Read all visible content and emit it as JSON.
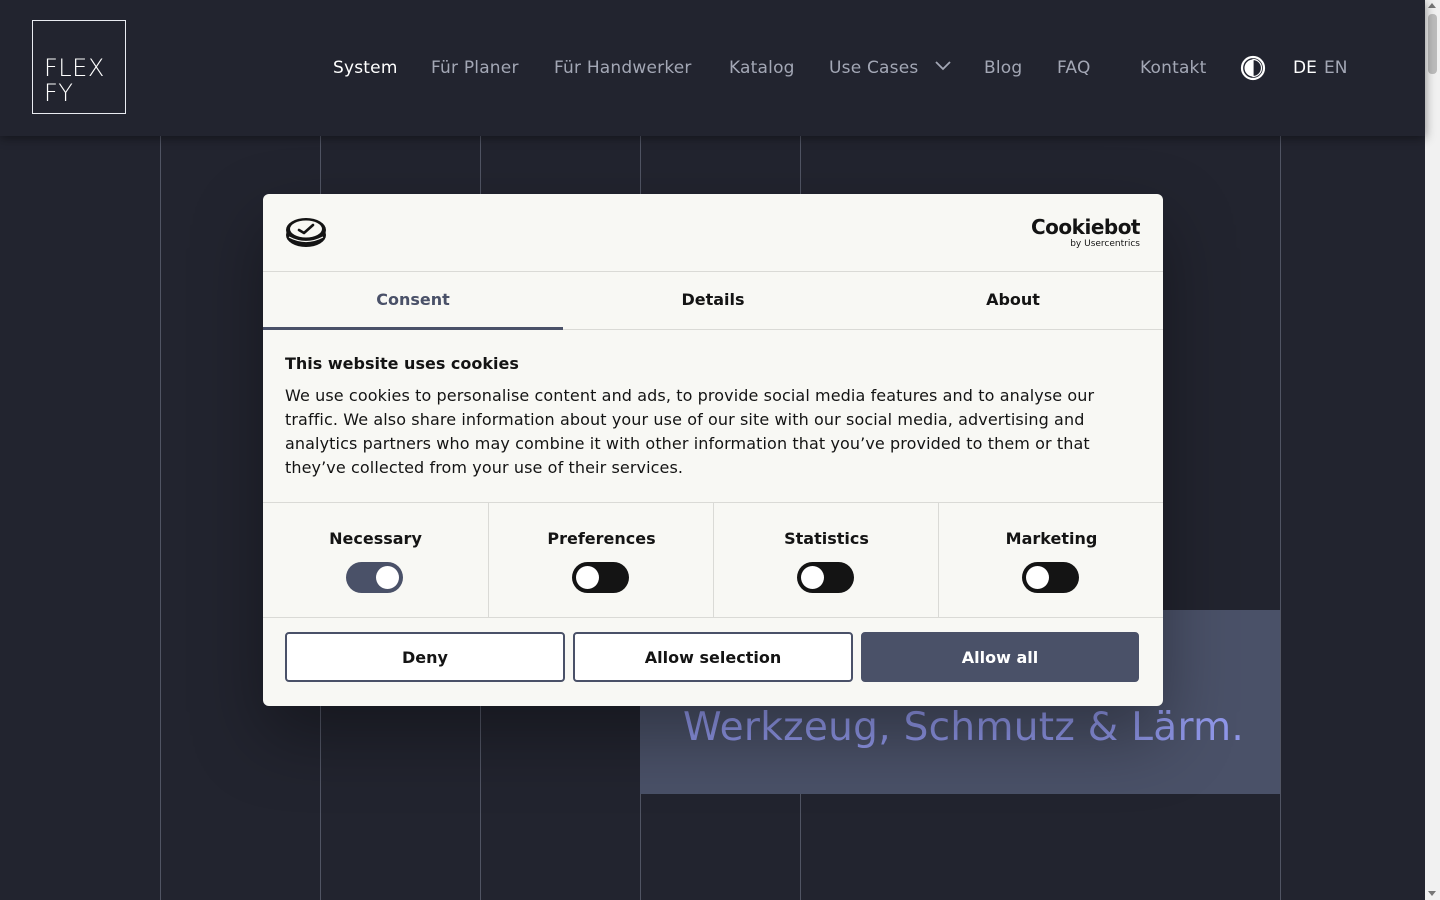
{
  "logo": {
    "line1": "FLEX",
    "line2": "FY"
  },
  "nav": {
    "items": [
      {
        "label": "System",
        "active": true
      },
      {
        "label": "Für Planer"
      },
      {
        "label": "Für Handwerker"
      },
      {
        "label": "Katalog"
      },
      {
        "label": "Use Cases",
        "has_dropdown": true
      },
      {
        "label": "Blog"
      },
      {
        "label": "FAQ"
      },
      {
        "label": "Kontakt"
      }
    ],
    "contrast_icon": "contrast-icon",
    "languages": [
      {
        "label": "DE",
        "active": true
      },
      {
        "label": "EN"
      }
    ]
  },
  "hero": {
    "text": "Werkzeug, Schmutz & Lärm."
  },
  "cookie_dialog": {
    "brand": {
      "name": "Cookiebot",
      "byline": "by Usercentrics"
    },
    "tabs": [
      {
        "label": "Consent",
        "active": true
      },
      {
        "label": "Details"
      },
      {
        "label": "About"
      }
    ],
    "title": "This website uses cookies",
    "body": "We use cookies to personalise content and ads, to provide social media features and to analyse our traffic. We also share information about your use of our site with our social media, advertising and analytics partners who may combine it with other information that you’ve provided to them or that they’ve collected from your use of their services.",
    "toggles": [
      {
        "label": "Necessary",
        "checked": true
      },
      {
        "label": "Preferences",
        "checked": false
      },
      {
        "label": "Statistics",
        "checked": false
      },
      {
        "label": "Marketing",
        "checked": false
      }
    ],
    "buttons": {
      "deny": "Deny",
      "allow_selection": "Allow selection",
      "allow_all": "Allow all"
    }
  },
  "colors": {
    "page_bg": "#22242f",
    "accent": "#4a5168",
    "hero_text": "#8f96e8",
    "dialog_bg": "#f8f8f4"
  }
}
